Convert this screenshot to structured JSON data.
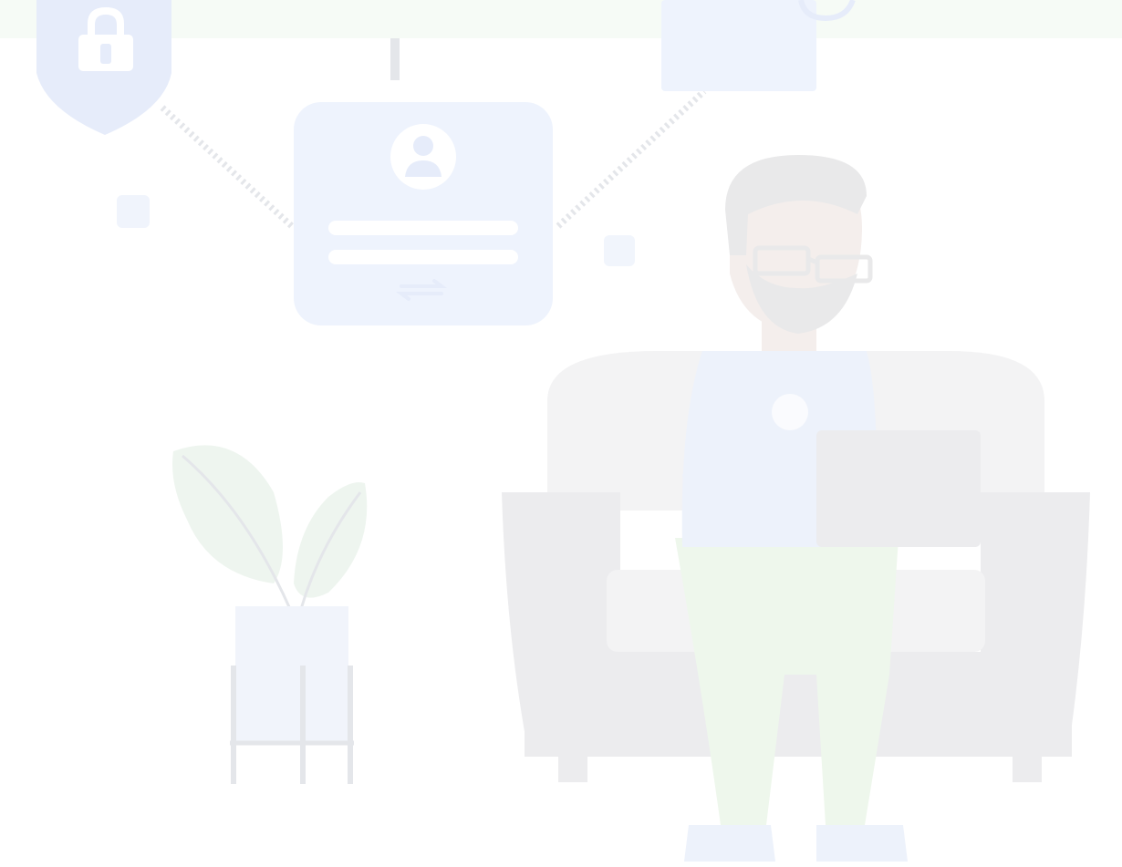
{
  "illustration": {
    "colors": {
      "page_background": "#ffffff",
      "top_banner": "#f6fbf6",
      "card_blue": "#eef3fd",
      "shield_blue": "#e6ecfa",
      "icon_white": "#ffffff",
      "dotted_connector": "#e4e6ea",
      "sofa_grey": "#f3f3f4",
      "sofa_dark": "#ececee",
      "shirt_blue": "#edf2fb",
      "pants_green": "#eef7ec",
      "leaf_green": "#eef5ef",
      "pot_blue": "#f1f4fb",
      "skin": "#f4eeec",
      "hair_grey": "#e9e9ea",
      "laptop_grey": "#ececee"
    },
    "icons": [
      "padlock-icon",
      "user-avatar-icon",
      "arrow-swap-icon"
    ],
    "scene": "person-on-sofa-with-laptop"
  }
}
